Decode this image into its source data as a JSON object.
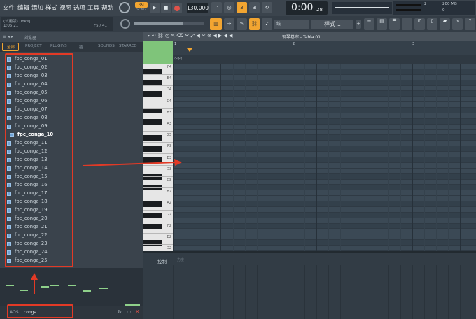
{
  "menu": [
    "文件",
    "编辑",
    "添加",
    "样式",
    "视图",
    "选项",
    "工具",
    "帮助"
  ],
  "transport": {
    "pat_song": "PAT",
    "song_label": "SONG",
    "tempo": "130.000",
    "time": "0:00",
    "time_small": "28",
    "pattern_name": "样式 1",
    "meter_values": [
      "2",
      "200 MB",
      "0"
    ]
  },
  "hint": {
    "line1": "(试用版) [Inke]",
    "line2": "1:05:21",
    "counter": "F5 / 41"
  },
  "browser": {
    "title": "浏览器",
    "tabs": [
      "全部",
      "PROJECT",
      "PLUGINS",
      "插",
      "SOUNDS",
      "STARRED"
    ],
    "files": [
      "fpc_conga_01",
      "fpc_conga_02",
      "fpc_conga_03",
      "fpc_conga_04",
      "fpc_conga_05",
      "fpc_conga_06",
      "fpc_conga_07",
      "fpc_conga_08",
      "fpc_conga_09",
      "fpc_conga_10",
      "fpc_conga_11",
      "fpc_conga_12",
      "fpc_conga_13",
      "fpc_conga_14",
      "fpc_conga_15",
      "fpc_conga_16",
      "fpc_conga_17",
      "fpc_conga_18",
      "fpc_conga_19",
      "fpc_conga_20",
      "fpc_conga_21",
      "fpc_conga_22",
      "fpc_conga_23",
      "fpc_conga_24",
      "fpc_conga_25"
    ],
    "selected_file": "fpc_conga_10",
    "search_label": "AOS",
    "search_value": "conga"
  },
  "piano_roll": {
    "title": "钢琴卷帘 - Tabla 01",
    "bar_numbers": [
      "1",
      "2",
      "3"
    ],
    "octave_labels": [
      "F4",
      "E4",
      "D4",
      "C4",
      "B3",
      "A3",
      "G3",
      "F3",
      "E3",
      "D3",
      "C3",
      "B2",
      "A2",
      "G2",
      "F2",
      "E2",
      "D2"
    ],
    "control_label": "控制",
    "control_sub": "力度"
  },
  "colors": {
    "highlight": "#e23a26",
    "accent_orange": "#f2a531",
    "note_green": "#8fd18a"
  }
}
